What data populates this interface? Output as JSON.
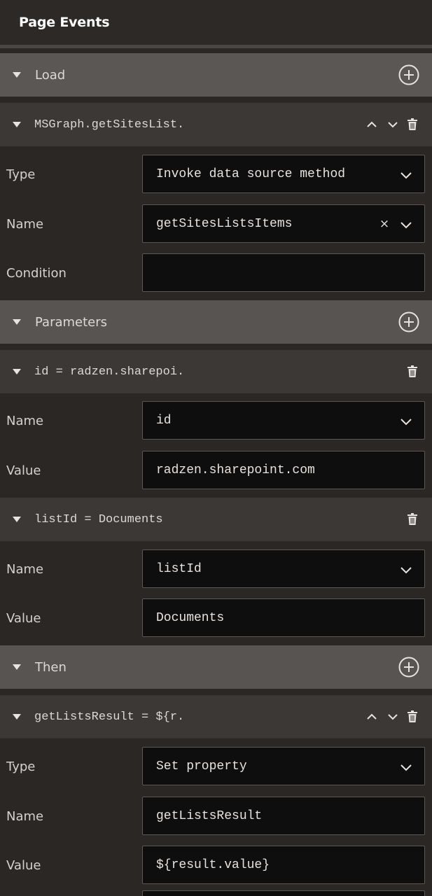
{
  "header": {
    "title": "Page Events"
  },
  "events": [
    {
      "group": "Load",
      "actions": [
        {
          "label": "MSGraph.getSitesList.",
          "fields": [
            {
              "label": "Type",
              "value": "Invoke data source method",
              "dropdown": true
            },
            {
              "label": "Name",
              "value": "getSitesListsItems",
              "dropdown": true,
              "clearable": true,
              "clear_glyph": "×"
            },
            {
              "label": "Condition",
              "value": ""
            }
          ],
          "parameters_group": "Parameters",
          "parameters": [
            {
              "label": "id = radzen.sharepoi.",
              "name": "id",
              "value": "radzen.sharepoint.com"
            },
            {
              "label": "listId = Documents",
              "name": "listId",
              "value": "Documents"
            }
          ],
          "then_group": "Then",
          "then": [
            {
              "label": "getListsResult = ${r.",
              "fields": [
                {
                  "label": "Type",
                  "value": "Set property",
                  "dropdown": true
                },
                {
                  "label": "Name",
                  "value": "getListsResult"
                },
                {
                  "label": "Value",
                  "value": "${result.value}"
                }
              ]
            }
          ]
        }
      ]
    }
  ],
  "field_labels": {
    "name": "Name",
    "value": "Value"
  },
  "icons": {
    "expand": "triangle-down-icon",
    "add": "plus-circle-icon",
    "move_up": "chevron-up-icon",
    "move_down": "chevron-down-icon",
    "delete": "trash-icon",
    "dropdown": "chevron-down-icon"
  },
  "colors": {
    "background": "#2a2725",
    "group_header": "#575451",
    "action_header": "#3b3835",
    "input_bg": "#0f0e0e",
    "text": "#dcd9d6"
  }
}
